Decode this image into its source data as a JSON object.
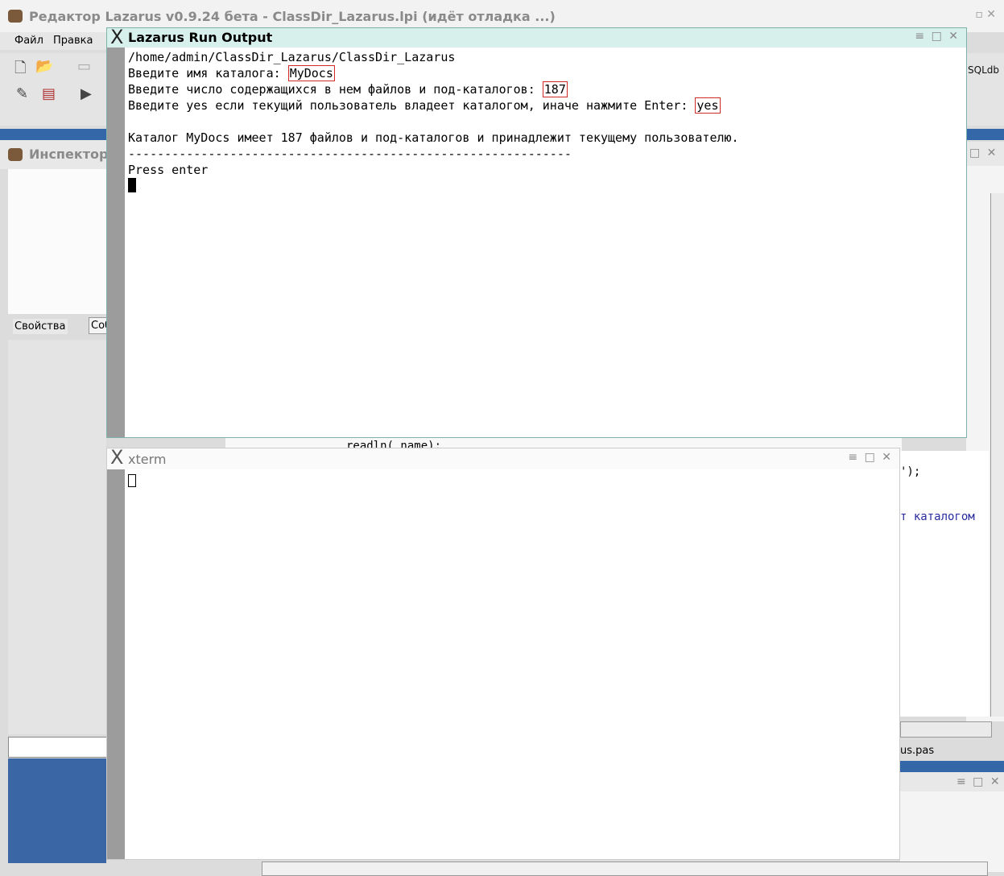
{
  "ide": {
    "title": "Редактор Lazarus v0.9.24 бета - ClassDir_Lazarus.lpi (идёт отладка ...)",
    "menu": [
      "Файл",
      "Правка"
    ],
    "inspector_title": "Инспектор",
    "tab_properties": "Свойства",
    "tab_events": "Соб",
    "sqldb_label": "SQLdb",
    "code_line_1": "');",
    "code_line_2": "т каталогом",
    "under_code": "readln( name);",
    "file_tab": "us.pas"
  },
  "run_output": {
    "title": "Lazarus Run Output",
    "lines": {
      "path": "/home/admin/ClassDir_Lazarus/ClassDir_Lazarus",
      "prompt_name": "Введите имя каталога: ",
      "value_name": "MyDocs",
      "prompt_count": "Введите число содержащихся в нем файлов и под-каталогов: ",
      "value_count": "187",
      "prompt_owner": "Введите yes если текущий пользователь владеет каталогом, иначе нажмите Enter: ",
      "value_owner": "yes",
      "result": "Каталог MyDocs имеет 187 файлов и под-каталогов и принадлежит текущему пользователю.",
      "separator": "-------------------------------------------------------------",
      "press_enter": "Press enter"
    }
  },
  "xterm": {
    "title": "xterm"
  },
  "colors": {
    "highlight_box": "#d12a2a",
    "title_bar": "#d8f0ec",
    "ide_blue": "#3467a8"
  }
}
